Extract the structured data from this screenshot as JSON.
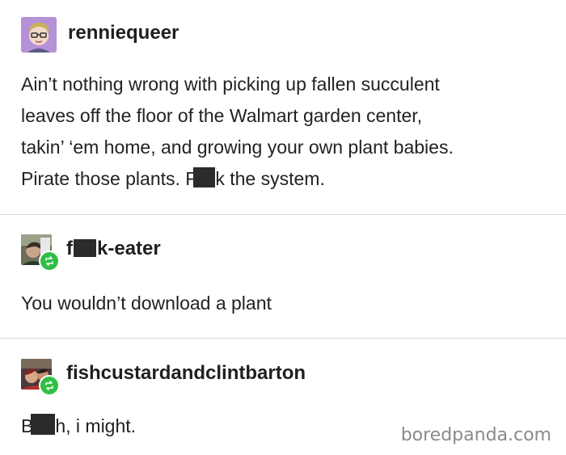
{
  "post1": {
    "username": "renniequeer",
    "lines": [
      "Ain’t nothing wrong with picking up fallen succulent",
      "leaves off the floor of the Walmart garden center,",
      "takin’ ‘em home, and growing your own plant babies."
    ],
    "last_line_pre": "Pirate those plants. F",
    "last_line_post": "k the system."
  },
  "post2": {
    "username_pre": "f",
    "username_post": "k-eater",
    "text": "You wouldn’t download a plant"
  },
  "post3": {
    "username": "fishcustardandclintbarton",
    "text_pre": "B",
    "text_post": "h, i might."
  },
  "watermark": "boredpanda.com",
  "icons": {
    "post1_avatar": "avatar-icon",
    "reblog": "reblog-icon"
  }
}
